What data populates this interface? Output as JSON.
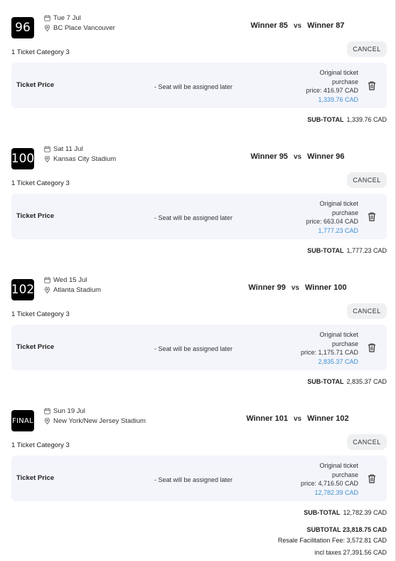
{
  "matches": [
    {
      "badge": "96",
      "date": "Tue 7 Jul",
      "venue": "BC Place Vancouver",
      "team_a": "Winner 85",
      "vs": "vs",
      "team_b": "Winner 87",
      "category": "1 Ticket Category 3",
      "cancel": "CANCEL",
      "ticket_label": "Ticket Price",
      "seat_note": "- Seat will be assigned later",
      "orig_line1": "Original ticket",
      "orig_line2": "purchase",
      "orig_line3": "price: 416.97 CAD",
      "price_total": "1,339.76 CAD",
      "subtotal_label": "SUB-TOTAL",
      "subtotal_value": "1,339.76 CAD"
    },
    {
      "badge": "100",
      "date": "Sat 11 Jul",
      "venue": "Kansas City Stadium",
      "team_a": "Winner 95",
      "vs": "vs",
      "team_b": "Winner 96",
      "category": "1 Ticket Category 3",
      "cancel": "CANCEL",
      "ticket_label": "Ticket Price",
      "seat_note": "- Seat will be assigned later",
      "orig_line1": "Original ticket",
      "orig_line2": "purchase",
      "orig_line3": "price: 663.04 CAD",
      "price_total": "1,777.23 CAD",
      "subtotal_label": "SUB-TOTAL",
      "subtotal_value": "1,777.23 CAD"
    },
    {
      "badge": "102",
      "date": "Wed 15 Jul",
      "venue": "Atlanta Stadium",
      "team_a": "Winner 99",
      "vs": "vs",
      "team_b": "Winner 100",
      "category": "1 Ticket Category 3",
      "cancel": "CANCEL",
      "ticket_label": "Ticket Price",
      "seat_note": "- Seat will be assigned later",
      "orig_line1": "Original ticket",
      "orig_line2": "purchase",
      "orig_line3": "price: 1,175.71 CAD",
      "price_total": "2,835.37 CAD",
      "subtotal_label": "SUB-TOTAL",
      "subtotal_value": "2,835.37 CAD"
    },
    {
      "badge": "FINAL",
      "date": "Sun 19 Jul",
      "venue": "New York/New Jersey Stadium",
      "team_a": "Winner 101",
      "vs": "vs",
      "team_b": "Winner 102",
      "category": "1 Ticket Category 3",
      "cancel": "CANCEL",
      "ticket_label": "Ticket Price",
      "seat_note": "- Seat will be assigned later",
      "orig_line1": "Original ticket",
      "orig_line2": "purchase",
      "orig_line3": "price: 4,716.50 CAD",
      "price_total": "12,782.39 CAD",
      "subtotal_label": "SUB-TOTAL",
      "subtotal_value": "12,782.39 CAD"
    }
  ],
  "summary": {
    "subtotal": "SUBTOTAL 23,818.75 CAD",
    "resale_fee": "Resale Facilitation Fee: 3,572.81 CAD",
    "incl_taxes": "incl taxes 27,391.56 CAD"
  },
  "icons": {
    "calendar": "calendar-icon",
    "location": "location-pin-icon",
    "trash": "trash-icon"
  },
  "colors": {
    "accent_price": "#3d8fd1",
    "ticket_box_bg": "#f4f5fb",
    "cancel_bg": "#eef0f1",
    "badge_bg": "#000000"
  }
}
